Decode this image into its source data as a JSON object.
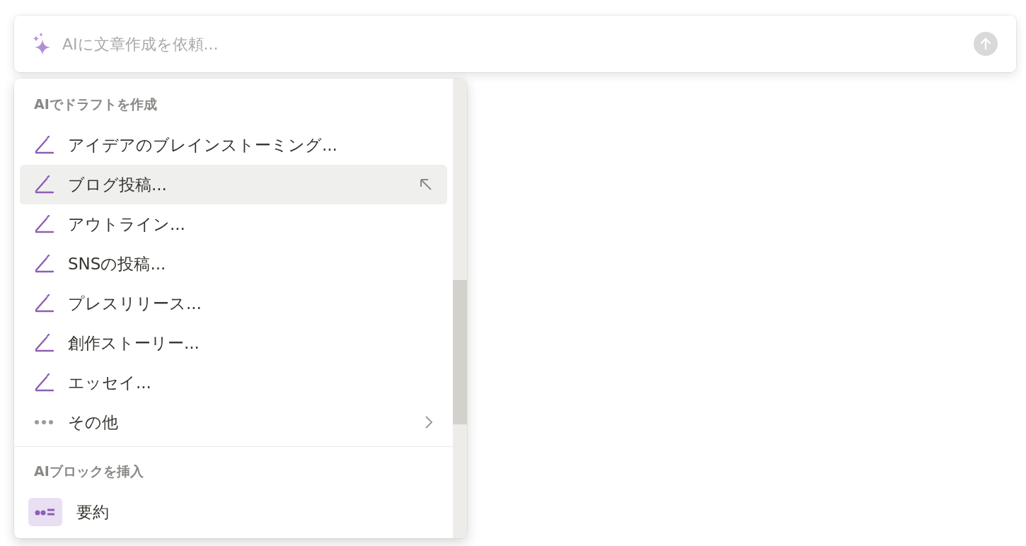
{
  "prompt": {
    "placeholder": "AIに文章作成を依頼..."
  },
  "menu": {
    "sections": [
      {
        "heading": "AIでドラフトを作成",
        "items": [
          {
            "kind": "draft",
            "label": "アイデアのブレインストーミング...",
            "selected": false
          },
          {
            "kind": "draft",
            "label": "ブログ投稿...",
            "selected": true
          },
          {
            "kind": "draft",
            "label": "アウトライン...",
            "selected": false
          },
          {
            "kind": "draft",
            "label": "SNSの投稿...",
            "selected": false
          },
          {
            "kind": "draft",
            "label": "プレスリリース...",
            "selected": false
          },
          {
            "kind": "draft",
            "label": "創作ストーリー...",
            "selected": false
          },
          {
            "kind": "draft",
            "label": "エッセイ...",
            "selected": false
          },
          {
            "kind": "more",
            "label": "その他",
            "selected": false
          }
        ]
      },
      {
        "heading": "AIブロックを挿入",
        "items": [
          {
            "kind": "block",
            "label": "要約",
            "selected": false
          }
        ]
      }
    ]
  }
}
